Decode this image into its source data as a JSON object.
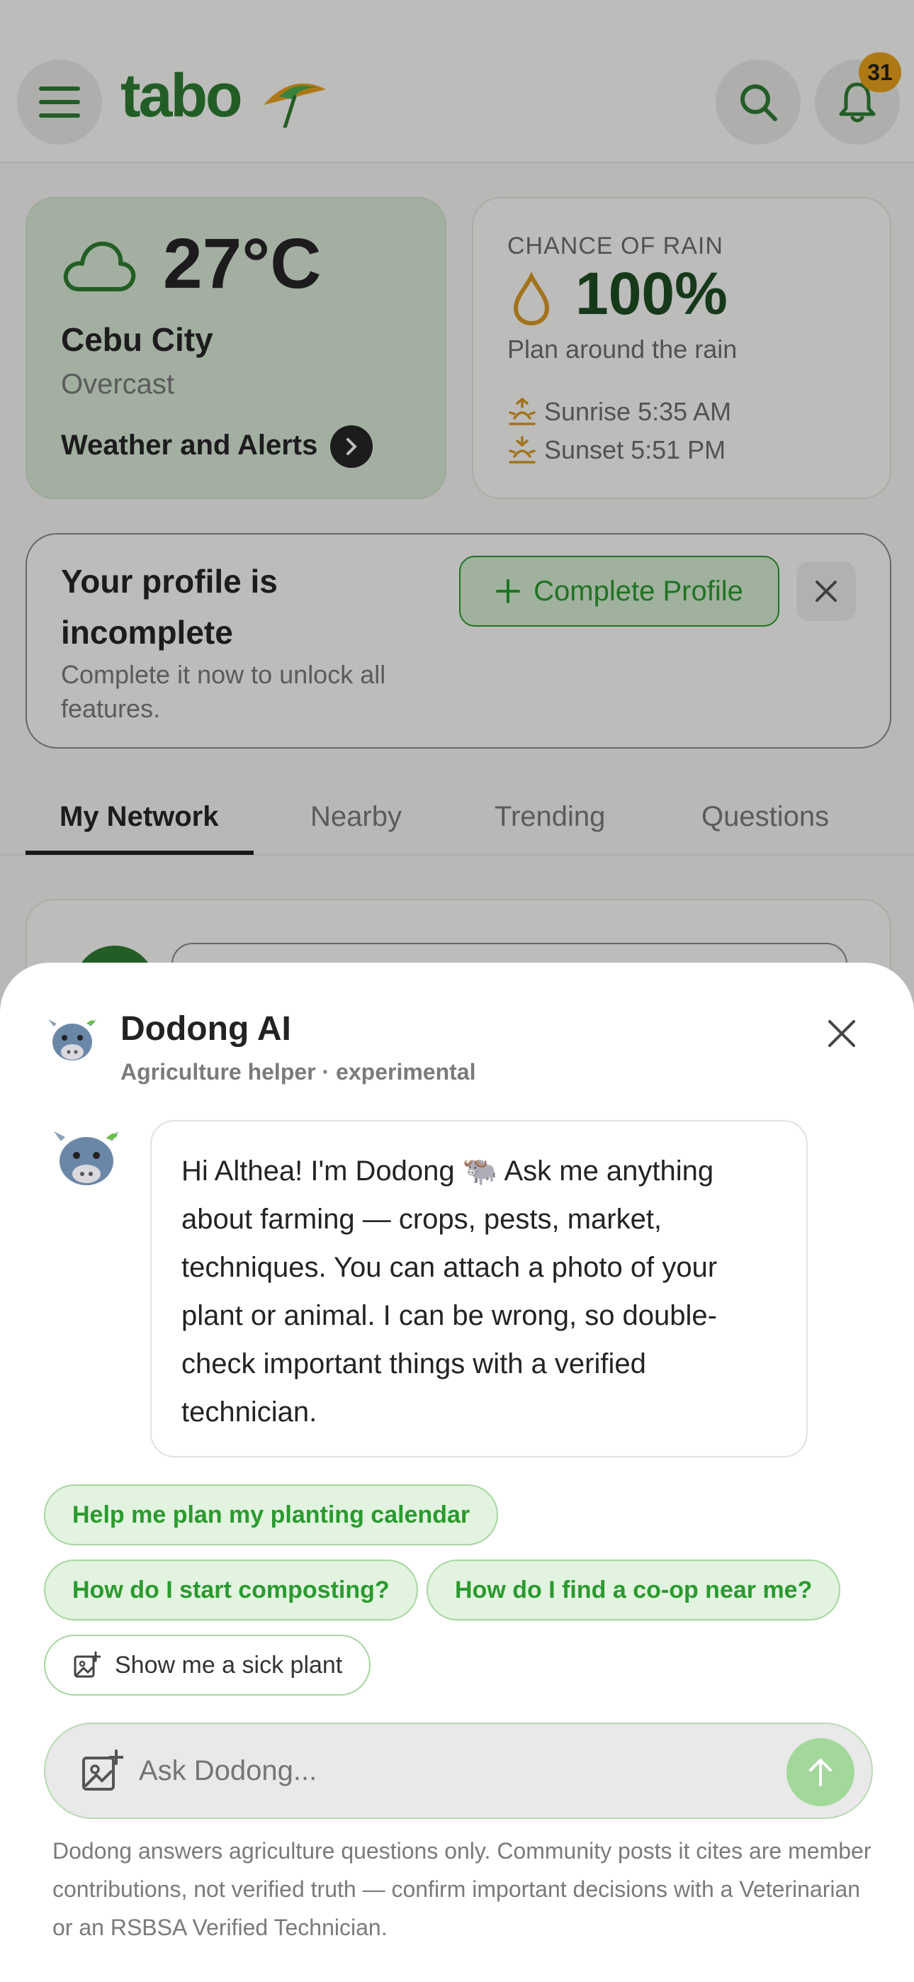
{
  "header": {
    "logo": "tabo",
    "notification_count": "31",
    "icons": [
      "menu-icon",
      "umbrella-icon",
      "search-icon",
      "bell-icon"
    ]
  },
  "weather": {
    "temperature": "27°C",
    "city": "Cebu City",
    "condition": "Overcast",
    "link_label": "Weather and Alerts"
  },
  "rain": {
    "heading": "CHANCE OF RAIN",
    "percent": "100%",
    "advice": "Plan around the rain",
    "sunrise": "Sunrise 5:35 AM",
    "sunset": "Sunset 5:51 PM"
  },
  "profile_prompt": {
    "title": "Your profile is incomplete",
    "subtitle": "Complete it now to unlock all features.",
    "button_label": "Complete Profile"
  },
  "tabs": [
    {
      "label": "My Network",
      "active": true
    },
    {
      "label": "Nearby",
      "active": false
    },
    {
      "label": "Trending",
      "active": false
    },
    {
      "label": "Questions",
      "active": false
    }
  ],
  "assistant": {
    "name": "Dodong AI",
    "tagline": "Agriculture helper · experimental",
    "greeting": "Hi Althea! I'm Dodong 🐃 Ask me anything about farming — crops, pests, market, techniques. You can attach a photo of your plant or animal. I can be wrong, so double-check important things with a verified technician.",
    "suggestions": [
      "Help me plan my planting calendar",
      "How do I start composting?",
      "How do I find a co-op near me?"
    ],
    "photo_suggestion": "Show me a sick plant",
    "input_placeholder": "Ask Dodong...",
    "disclaimer": "Dodong answers agriculture questions only. Community posts it cites are member contributions, not verified truth — confirm important decisions with a Veterinarian or an RSBSA Verified Technician."
  },
  "colors": {
    "brand_green": "#2e7d32",
    "chip_green": "#2a9a2f",
    "badge_orange": "#e8a21b",
    "rain_orange": "#d99a26",
    "send_button": "#a3d89b"
  }
}
